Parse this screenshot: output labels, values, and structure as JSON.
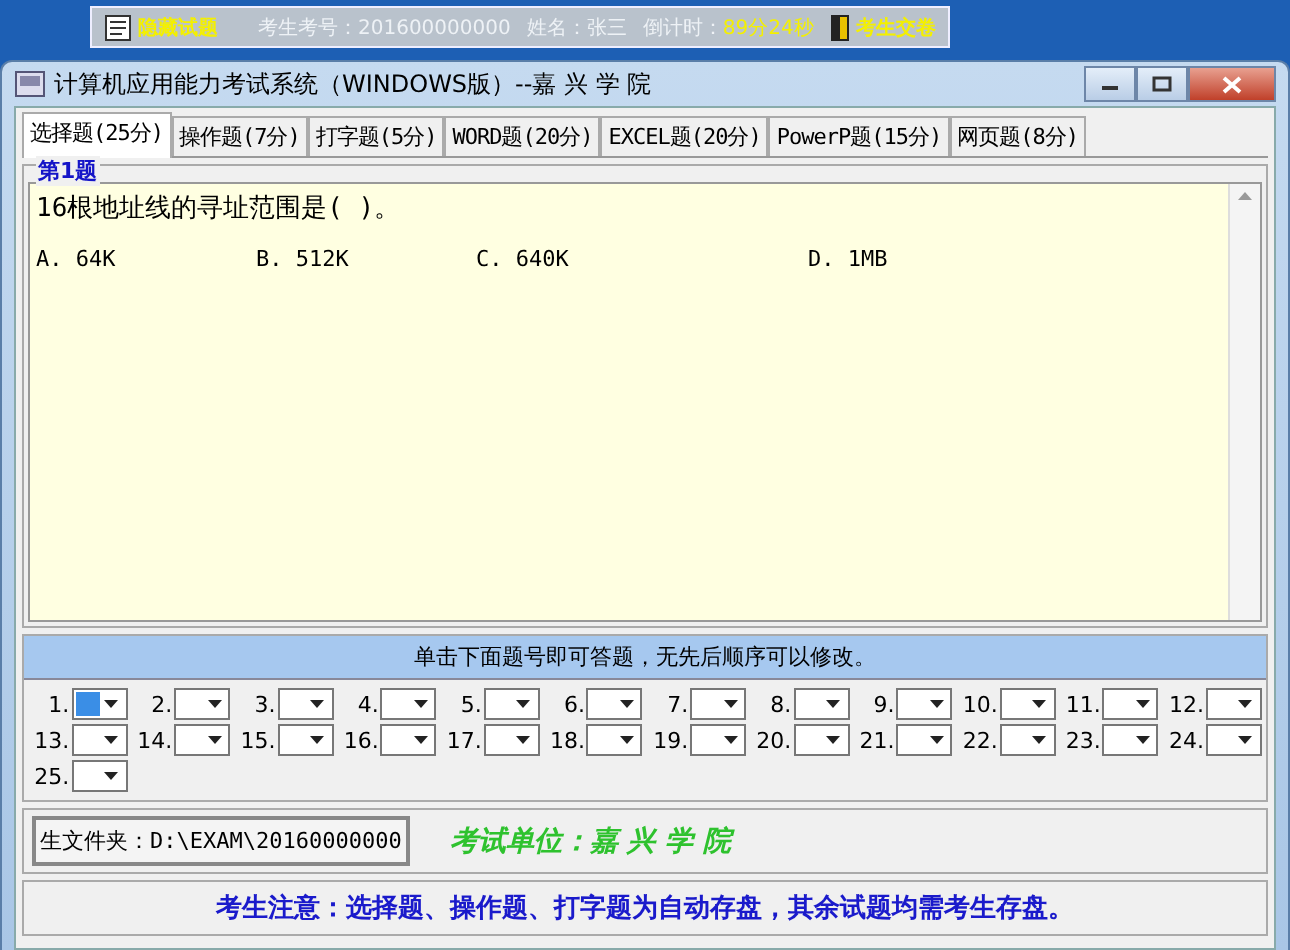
{
  "top_bar": {
    "hide_button": "隐藏试题",
    "exam_number": "考生考号：201600000000",
    "name": "姓名：张三",
    "countdown_label": "倒计时：",
    "countdown": "89分24秒",
    "submit_button": "考生交卷"
  },
  "window": {
    "title": "计算机应用能力考试系统（WINDOWS版）--嘉 兴 学 院"
  },
  "tabs": [
    {
      "label": "选择题(25分)",
      "selected": true
    },
    {
      "label": "操作题(7分)",
      "selected": false
    },
    {
      "label": "打字题(5分)",
      "selected": false
    },
    {
      "label": "WORD题(20分)",
      "selected": false
    },
    {
      "label": "EXCEL题(20分)",
      "selected": false
    },
    {
      "label": "PowerP题(15分)",
      "selected": false
    },
    {
      "label": "网页题(8分)",
      "selected": false
    }
  ],
  "question": {
    "group_title": "第1题",
    "text": "16根地址线的寻址范围是(    )。",
    "options": [
      "A. 64K",
      "B. 512K",
      "C. 640K",
      "D. 1MB"
    ]
  },
  "answers": {
    "hint": "单击下面题号即可答题，无先后顺序可以修改。",
    "items": [
      {
        "number": "1.",
        "selected": true
      },
      {
        "number": "2.",
        "selected": false
      },
      {
        "number": "3.",
        "selected": false
      },
      {
        "number": "4.",
        "selected": false
      },
      {
        "number": "5.",
        "selected": false
      },
      {
        "number": "6.",
        "selected": false
      },
      {
        "number": "7.",
        "selected": false
      },
      {
        "number": "8.",
        "selected": false
      },
      {
        "number": "9.",
        "selected": false
      },
      {
        "number": "10.",
        "selected": false
      },
      {
        "number": "11.",
        "selected": false
      },
      {
        "number": "12.",
        "selected": false
      },
      {
        "number": "13.",
        "selected": false
      },
      {
        "number": "14.",
        "selected": false
      },
      {
        "number": "15.",
        "selected": false
      },
      {
        "number": "16.",
        "selected": false
      },
      {
        "number": "17.",
        "selected": false
      },
      {
        "number": "18.",
        "selected": false
      },
      {
        "number": "19.",
        "selected": false
      },
      {
        "number": "20.",
        "selected": false
      },
      {
        "number": "21.",
        "selected": false
      },
      {
        "number": "22.",
        "selected": false
      },
      {
        "number": "23.",
        "selected": false
      },
      {
        "number": "24.",
        "selected": false
      },
      {
        "number": "25.",
        "selected": false
      }
    ]
  },
  "folder": "生文件夹：D:\\EXAM\\20160000000",
  "unit": "考试单位：嘉 兴 学 院",
  "notice": "考生注意：选择题、操作题、打字题为自动存盘，其余试题均需考生存盘。"
}
